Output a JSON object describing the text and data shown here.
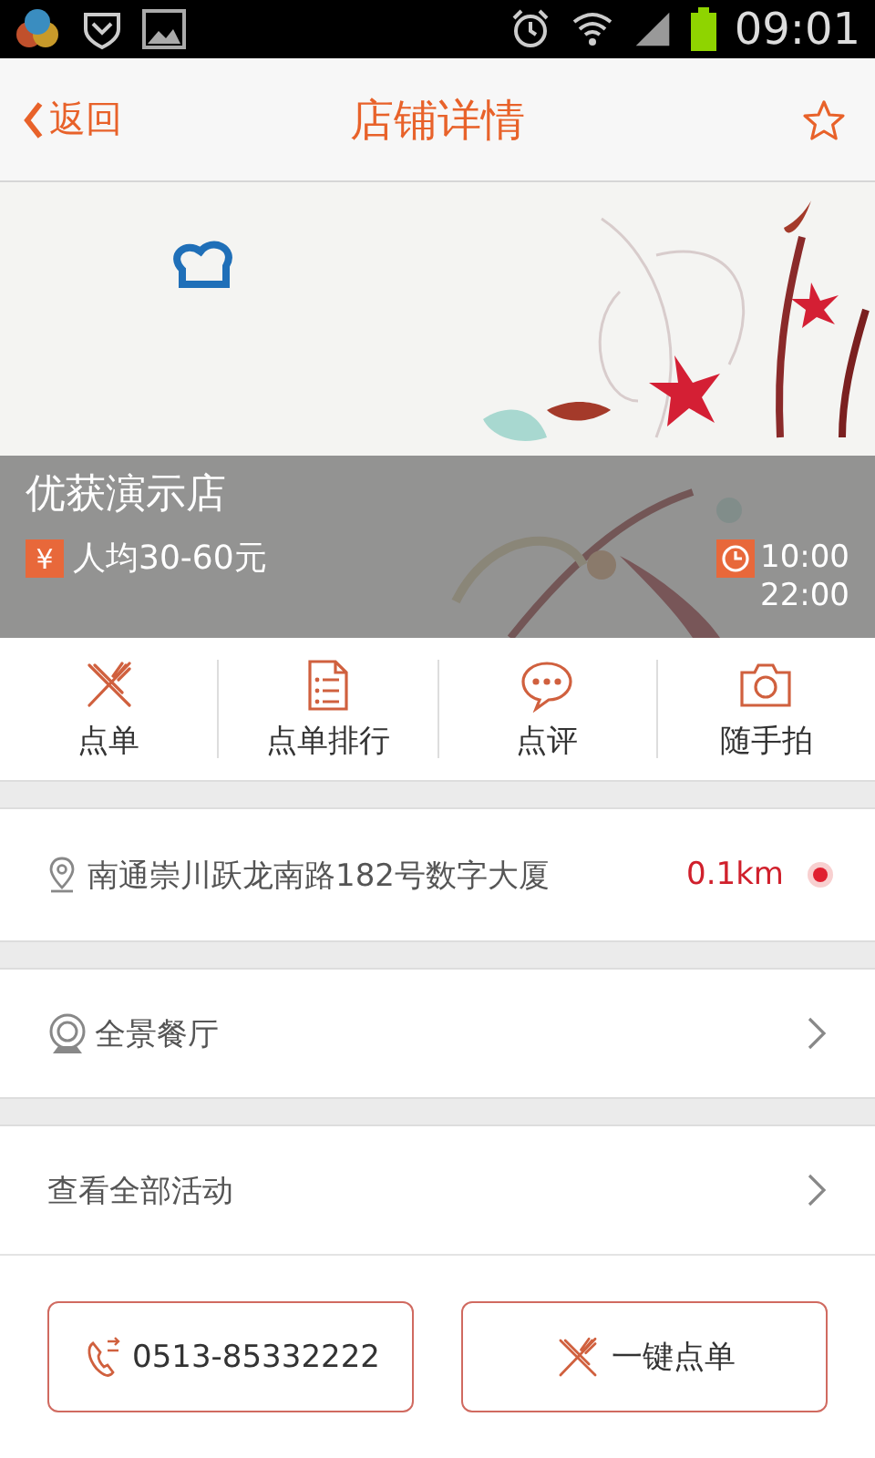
{
  "status_bar": {
    "time": "09:01"
  },
  "header": {
    "back": "返回",
    "title": "店铺详情",
    "favorite": false
  },
  "banner": {
    "kind": "picture",
    "name": "优获演示店",
    "price_icon": "¥",
    "price": "人均30-60元",
    "hours": [
      "10:00",
      "22:00"
    ]
  },
  "actions": [
    {
      "kind": "cutlery",
      "label": "点单"
    },
    {
      "kind": "list",
      "label": "点单排行"
    },
    {
      "kind": "chat",
      "label": "点评"
    },
    {
      "kind": "camera",
      "label": "随手拍"
    }
  ],
  "address": {
    "text": "南通崇川跃龙南路182号数字大厦",
    "distance": "0.1km"
  },
  "rows": [
    {
      "kind": "panorama",
      "label": "全景餐厅"
    },
    {
      "kind": "plain",
      "label": "查看全部活动"
    }
  ],
  "buttons": [
    {
      "kind": "phone",
      "label": "0513-85332222"
    },
    {
      "kind": "order",
      "label": "一键点单"
    }
  ]
}
